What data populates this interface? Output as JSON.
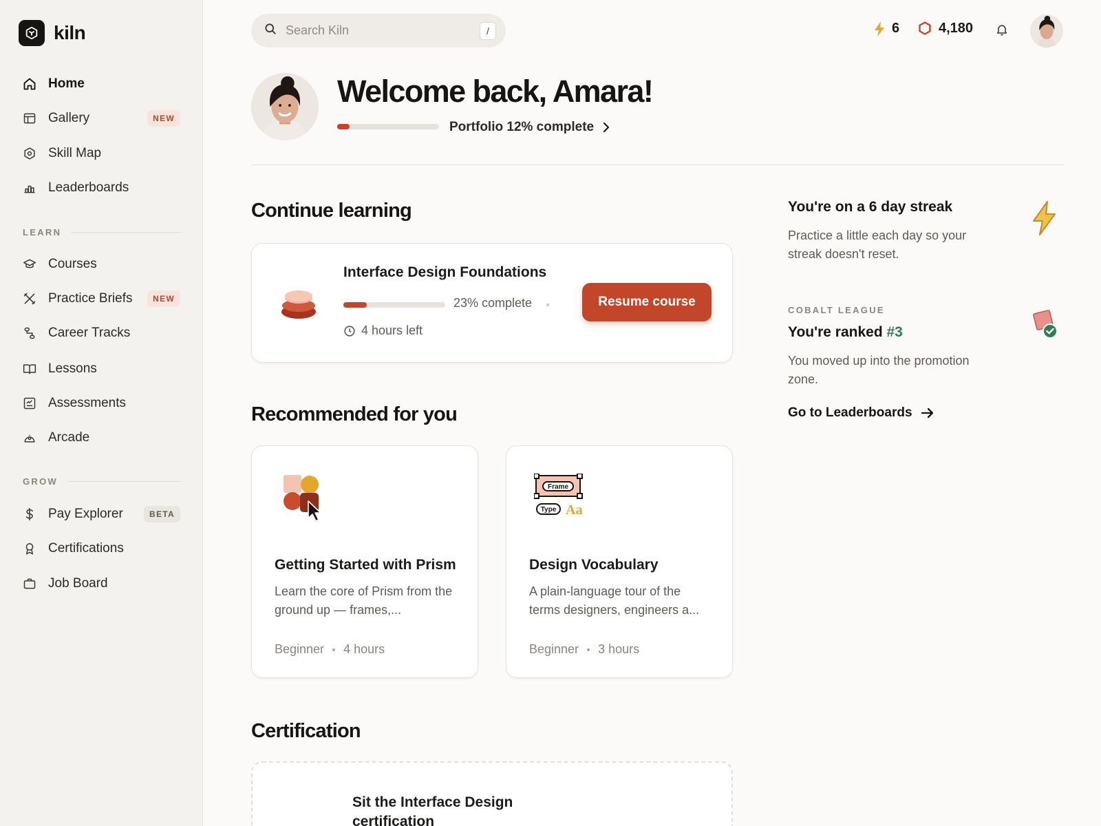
{
  "brand": {
    "name": "kiln",
    "icon": "hexagon-cube-icon"
  },
  "search": {
    "placeholder": "Search Kiln",
    "shortcut": "/"
  },
  "header": {
    "streak_count": "6",
    "gems_count": "4,180"
  },
  "sidebar": {
    "main": [
      {
        "label": "Home",
        "icon": "home-icon",
        "active": true
      },
      {
        "label": "Gallery",
        "icon": "gallery-icon",
        "badge": "NEW"
      },
      {
        "label": "Skill Map",
        "icon": "skill-map-icon"
      },
      {
        "label": "Leaderboards",
        "icon": "leaderboard-icon"
      }
    ],
    "learn_heading": "LEARN",
    "learn": [
      {
        "label": "Courses",
        "icon": "graduation-cap-icon"
      },
      {
        "label": "Practice Briefs",
        "icon": "practice-icon",
        "badge": "NEW"
      },
      {
        "label": "Career Tracks",
        "icon": "career-tracks-icon"
      },
      {
        "label": "Lessons",
        "icon": "book-icon"
      },
      {
        "label": "Assessments",
        "icon": "assessment-icon"
      },
      {
        "label": "Arcade",
        "icon": "arcade-icon"
      }
    ],
    "grow_heading": "GROW",
    "grow": [
      {
        "label": "Pay Explorer",
        "icon": "dollar-icon",
        "badge": "BETA"
      },
      {
        "label": "Certifications",
        "icon": "award-icon"
      },
      {
        "label": "Job Board",
        "icon": "briefcase-icon"
      }
    ]
  },
  "welcome": {
    "title": "Welcome back, Amara!",
    "portfolio_label": "Portfolio 12% complete",
    "portfolio_progress": 0.12
  },
  "continue": {
    "heading": "Continue learning",
    "course_title": "Interface Design Foundations",
    "progress_label": "23% complete",
    "progress": 0.23,
    "time_left": "4 hours left",
    "button": "Resume course"
  },
  "recommended": {
    "heading": "Recommended for you",
    "items": [
      {
        "title": "Getting Started with Prism",
        "description": "Learn the core of Prism from the ground up — frames,...",
        "level": "Beginner",
        "duration": "4 hours"
      },
      {
        "title": "Design Vocabulary",
        "description": "A plain-language tour of the terms designers, engineers a...",
        "level": "Beginner",
        "duration": "3 hours",
        "art_labels": [
          "Frame",
          "Type",
          "Aa"
        ]
      }
    ]
  },
  "certification": {
    "heading": "Certification",
    "title": "Sit the Interface Design certification"
  },
  "streak": {
    "title": "You're on a 6 day streak",
    "text": "Practice a little each day so your streak doesn't reset."
  },
  "league": {
    "eyebrow": "COBALT LEAGUE",
    "title_prefix": "You're ranked ",
    "rank": "#3",
    "text": "You moved up into the promotion zone.",
    "link": "Go to Leaderboards"
  },
  "colors": {
    "accent": "#c2472a",
    "rank_green": "#2f7d55",
    "streak_yellow": "#e4a62e"
  }
}
